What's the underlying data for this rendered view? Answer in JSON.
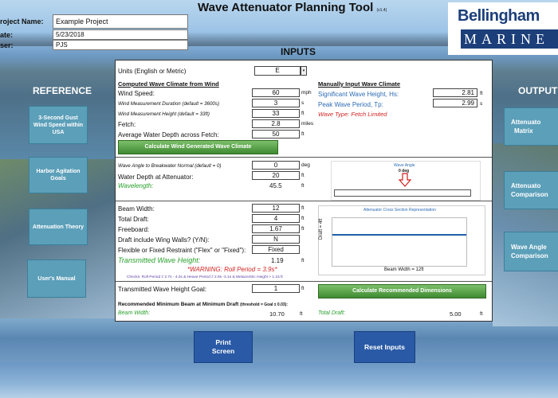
{
  "app": {
    "title": "Wave Attenuator Planning Tool",
    "version": "(v1.4)"
  },
  "project": {
    "name_label": "roject Name:",
    "name_value": "Example Project",
    "date_label": "ate:",
    "date_value": "5/23/2018",
    "user_label": "ser:",
    "user_value": "PJS"
  },
  "logo": {
    "top": "Bellingham",
    "bottom": "MARINE"
  },
  "sections": {
    "inputs": "INPUTS",
    "reference": "REFERENCE",
    "output": "OUTPUT"
  },
  "reference_buttons": [
    "3-Second Gust Wind Speed within USA",
    "Harbor Agitation Goals",
    "Attenuation Theory",
    "User's Manual"
  ],
  "output_buttons": [
    {
      "l1": "Attenuato",
      "l2": "Matrix"
    },
    {
      "l1": "Attenuato",
      "l2": "Comparison"
    },
    {
      "l1": "Wave Angle",
      "l2": "Comparison"
    }
  ],
  "units": {
    "label": "Units (English or Metric)",
    "value": "E"
  },
  "wind": {
    "heading": "Computed Wave Climate from Wind",
    "speed_label": "Wind Speed:",
    "speed_value": "60",
    "speed_unit": "mph",
    "duration_label": "Wind Measurement Duration (default = 3600s)",
    "duration_value": "3",
    "duration_unit": "s",
    "height_label": "Wind Measurement Height (default = 33ft)",
    "height_value": "33",
    "height_unit": "ft",
    "fetch_label": "Fetch:",
    "fetch_value": "2.8",
    "fetch_unit": "miles",
    "depth_label": "Average Water Depth across Fetch:",
    "depth_value": "50",
    "depth_unit": "ft",
    "calc_button": "Calculate Wind Generated Wave Climate"
  },
  "manual": {
    "heading": "Manually Input Wave Climate",
    "hs_label": "Significant Wave Height, Hs:",
    "hs_value": "2.81",
    "hs_unit": "ft",
    "tp_label": "Peak Wave Period, Tp:",
    "tp_value": "2.99",
    "tp_unit": "s",
    "wave_type": "Wave Type: Fetch Limited"
  },
  "angle": {
    "normal_label": "Wave Angle to Breakwater Normal (default = 0)",
    "normal_value": "0",
    "normal_unit": "deg",
    "depth_label": "Water Depth at Attenuator:",
    "depth_value": "20",
    "depth_unit": "ft",
    "wavelength_label": "Wavelength:",
    "wavelength_value": "45.5",
    "wavelength_unit": "ft",
    "diagram_title": "Wave Angle",
    "diagram_value": "0 deg"
  },
  "attenuator": {
    "beam_label": "Beam Width:",
    "beam_value": "12",
    "beam_unit": "ft",
    "draft_label": "Total Draft:",
    "draft_value": "4",
    "draft_unit": "ft",
    "freeboard_label": "Freeboard:",
    "freeboard_value": "1.67",
    "freeboard_unit": "ft",
    "wingwalls_label": "Draft include Wing Walls? (Y/N):",
    "wingwalls_value": "N",
    "restraint_label": "Flexible or Fixed Restraint (\"Flex\" or \"Fixed\"):",
    "restraint_value": "Fixed",
    "transmitted_label": "Transmitted Wave Height:",
    "transmitted_value": "1.19",
    "transmitted_unit": "ft",
    "warning": "*WARNING: Roll Period = 3.9s*",
    "checks": "Checks:  Roll Period ≠ 2.7s - 4.2s & Heave Period ≠ 2.8s -3.1s & Metacentric Height > 1.15 ft",
    "section_title": "Attenuator Cross Section Representation",
    "draft_axis": "Draft = 4ft",
    "beam_axis": "Beam Width = 12ft"
  },
  "recommend": {
    "goal_label": "Transmitted Wave Height Goal:",
    "goal_value": "1",
    "goal_unit": "ft",
    "calc_button": "Calculate Recommended Dimensions",
    "heading": "Recommended Minimum Beam at Minimum Draft",
    "heading_note": "(threshold = Goal ± 0.03):",
    "beam_label": "Beam Width:",
    "beam_value": "10.70",
    "beam_unit": "ft",
    "draft_label": "Total Draft:",
    "draft_value": "5.00",
    "draft_unit": "ft"
  },
  "bottom_buttons": {
    "print": "Print Screen",
    "reset": "Reset Inputs"
  },
  "colors": {
    "panel_bg": "#ffffff",
    "ref_button": "#5c9fb9",
    "calc_green": "#4f9a41",
    "bottom_button": "#2a5aa6",
    "label_blue": "#2c6bb5",
    "warning_red": "#d21f1f",
    "result_green": "#27a02a"
  }
}
